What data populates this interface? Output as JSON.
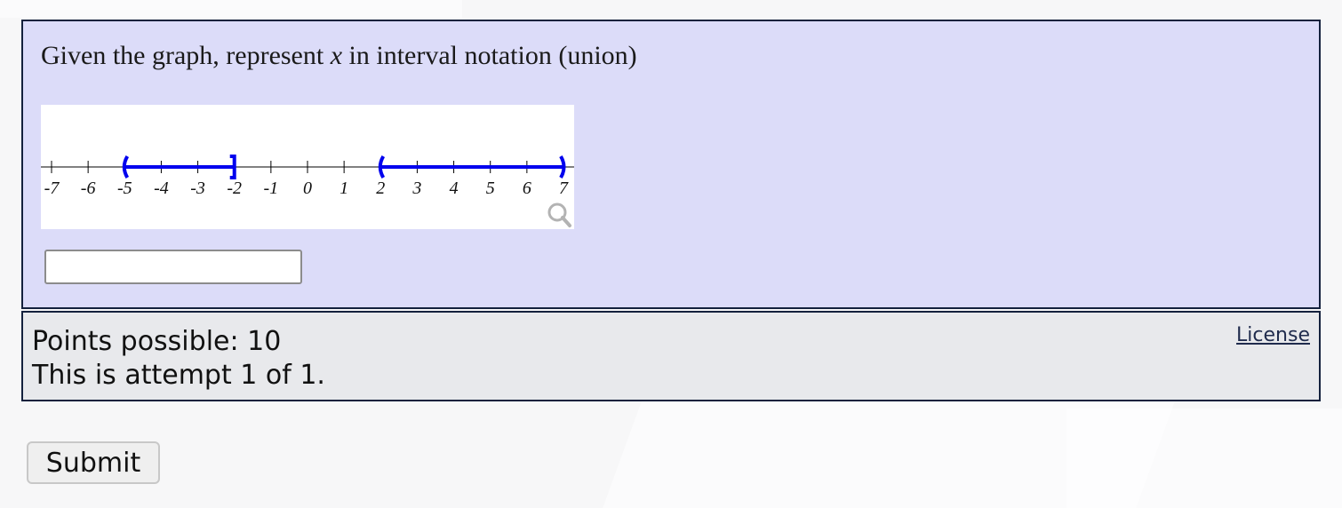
{
  "question": {
    "prefix": "Given the graph, represent ",
    "variable": "x",
    "suffix": " in interval notation (union)"
  },
  "number_line": {
    "min": -7,
    "max": 7,
    "tick_labels": [
      "-7",
      "-6",
      "-5",
      "-4",
      "-3",
      "-2",
      "-1",
      "0",
      "1",
      "2",
      "3",
      "4",
      "5",
      "6",
      "7"
    ],
    "intervals": [
      {
        "start": -5,
        "end": -2,
        "start_bracket": "(",
        "end_bracket": "]"
      },
      {
        "start": 2,
        "end": 7,
        "start_bracket": "(",
        "end_bracket": ")"
      }
    ],
    "line_color": "#0000ee",
    "zoom_icon": "magnifier-icon"
  },
  "answer_input": {
    "value": ""
  },
  "info": {
    "points_line": "Points possible: 10",
    "attempt_line": "This is attempt 1 of 1.",
    "license_label": "License"
  },
  "submit_label": "Submit"
}
